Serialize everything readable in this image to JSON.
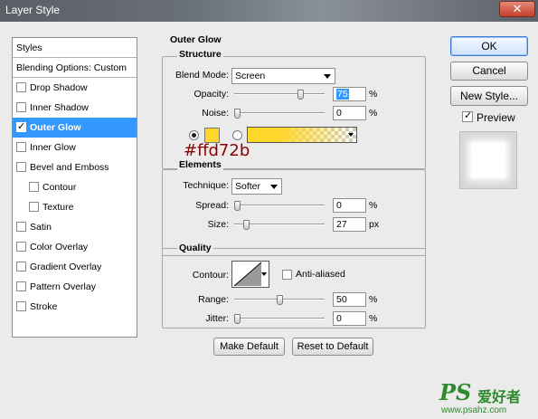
{
  "window": {
    "title": "Layer Style"
  },
  "styles_panel": {
    "header": "Styles",
    "blending_options": "Blending Options: Custom",
    "items": [
      {
        "label": "Drop Shadow",
        "checked": false,
        "indent": false
      },
      {
        "label": "Inner Shadow",
        "checked": false,
        "indent": false
      },
      {
        "label": "Outer Glow",
        "checked": true,
        "indent": false,
        "selected": true
      },
      {
        "label": "Inner Glow",
        "checked": false,
        "indent": false
      },
      {
        "label": "Bevel and Emboss",
        "checked": false,
        "indent": false
      },
      {
        "label": "Contour",
        "checked": false,
        "indent": true
      },
      {
        "label": "Texture",
        "checked": false,
        "indent": true
      },
      {
        "label": "Satin",
        "checked": false,
        "indent": false
      },
      {
        "label": "Color Overlay",
        "checked": false,
        "indent": false
      },
      {
        "label": "Gradient Overlay",
        "checked": false,
        "indent": false
      },
      {
        "label": "Pattern Overlay",
        "checked": false,
        "indent": false
      },
      {
        "label": "Stroke",
        "checked": false,
        "indent": false
      }
    ]
  },
  "outer_glow": {
    "title": "Outer Glow",
    "structure": {
      "title": "Structure",
      "blend_mode_label": "Blend Mode:",
      "blend_mode": "Screen",
      "opacity_label": "Opacity:",
      "opacity": "75",
      "opacity_level": 0.75,
      "noise_label": "Noise:",
      "noise": "0",
      "noise_level": 0,
      "unit": "%",
      "glow_color": "#ffd72b",
      "color_annotation": "#ffd72b"
    },
    "elements": {
      "title": "Elements",
      "technique_label": "Technique:",
      "technique": "Softer",
      "spread_label": "Spread:",
      "spread": "0",
      "spread_level": 0,
      "spread_unit": "%",
      "size_label": "Size:",
      "size": "27",
      "size_level": 0.11,
      "size_unit": "px"
    },
    "quality": {
      "title": "Quality",
      "contour_label": "Contour:",
      "anti_aliased_label": "Anti-aliased",
      "anti_aliased": false,
      "range_label": "Range:",
      "range": "50",
      "range_level": 0.5,
      "jitter_label": "Jitter:",
      "jitter": "0",
      "jitter_level": 0,
      "unit": "%"
    },
    "make_default_label": "Make Default",
    "reset_default_label": "Reset to Default"
  },
  "buttons": {
    "ok": "OK",
    "cancel": "Cancel",
    "new_style": "New Style...",
    "preview_label": "Preview",
    "preview_checked": true
  },
  "watermark": {
    "brand": "PS",
    "site_name": "爱好者",
    "url": "www.psahz.com"
  },
  "colors": {
    "selection": "#3399ff",
    "annotation_text": "#8b0000",
    "watermark_green": "#2e8b2e"
  }
}
